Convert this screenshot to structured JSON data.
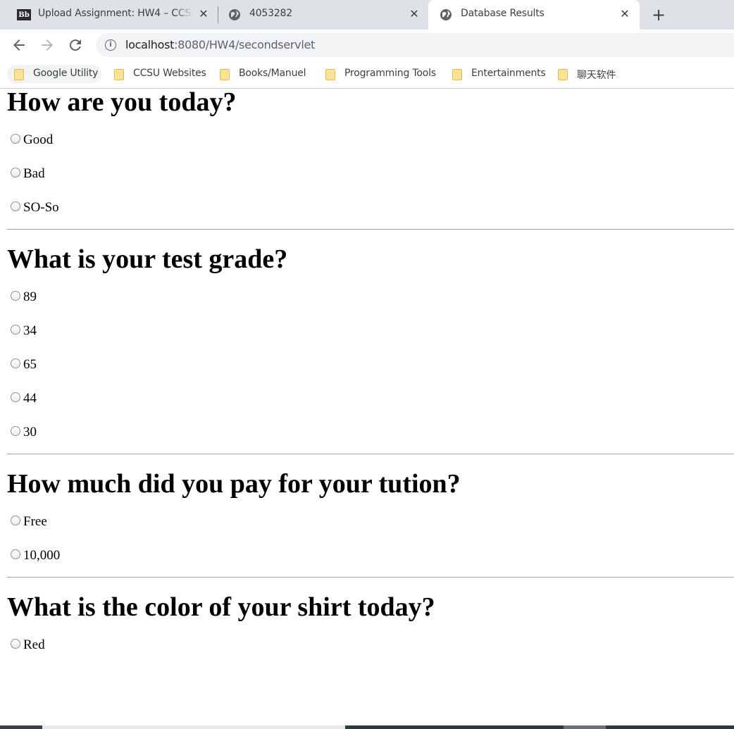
{
  "tabs": [
    {
      "title": "Upload Assignment: HW4 – CCSU",
      "favicon": "blackboard-icon"
    },
    {
      "title": "4053282",
      "favicon": "globe-icon"
    },
    {
      "title": "Database Results",
      "favicon": "globe-icon",
      "active": true
    }
  ],
  "address_bar": {
    "host": "localhost",
    "path": ":8080/HW4/secondservlet"
  },
  "bookmarks": [
    {
      "label": "Google Utility"
    },
    {
      "label": "CCSU Websites"
    },
    {
      "label": "Books/Manuel"
    },
    {
      "label": "Programming Tools"
    },
    {
      "label": "Entertainments"
    },
    {
      "label": "聊天软件"
    }
  ],
  "questions": [
    {
      "title": "How are you today?",
      "options": [
        "Good",
        "Bad",
        "SO-So"
      ]
    },
    {
      "title": "What is your test grade?",
      "options": [
        "89",
        "34",
        "65",
        "44",
        "30"
      ]
    },
    {
      "title": "How much did you pay for your tution?",
      "options": [
        "Free",
        "10,000"
      ]
    },
    {
      "title": "What is the color of your shirt today?",
      "options": [
        "Red"
      ]
    }
  ]
}
